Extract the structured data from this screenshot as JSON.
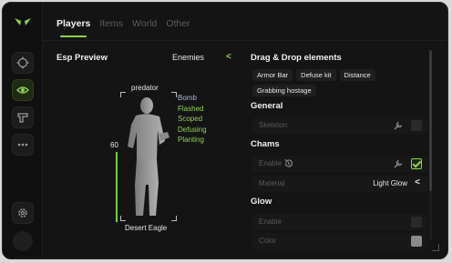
{
  "nav": {
    "tabs": [
      {
        "label": "Players",
        "active": true
      },
      {
        "label": "Items",
        "active": false
      },
      {
        "label": "World",
        "active": false
      },
      {
        "label": "Other",
        "active": false
      }
    ],
    "sidebar_icons": [
      "crosshair-icon",
      "eye-icon",
      "pistol-icon",
      "more-icon",
      "settings-icon"
    ]
  },
  "esp": {
    "title": "Esp Preview",
    "target": "Enemies",
    "player_name": "predator",
    "health": "60",
    "health_fraction": 1.0,
    "weapon": "Desert Eagle",
    "flags": [
      "Bomb",
      "Flashed",
      "Scoped",
      "Defusing",
      "Planting"
    ]
  },
  "panel": {
    "title": "Drag & Drop elements",
    "chips": [
      "Armor Bar",
      "Defuse kit",
      "Distance",
      "Grabbing hostage"
    ],
    "general": {
      "title": "General",
      "skeleton_label": "Skeleton",
      "skeleton_checked": false
    },
    "chams": {
      "title": "Chams",
      "enable_label": "Enable",
      "enable_checked": true,
      "material_label": "Material",
      "material_value": "Light Glow"
    },
    "glow": {
      "title": "Glow",
      "enable_label": "Enable",
      "enable_checked": false,
      "color_label": "Color"
    }
  },
  "colors": {
    "accent": "#8fd14f",
    "flag_bomb": "#a9b4e0",
    "background": "#141414"
  }
}
